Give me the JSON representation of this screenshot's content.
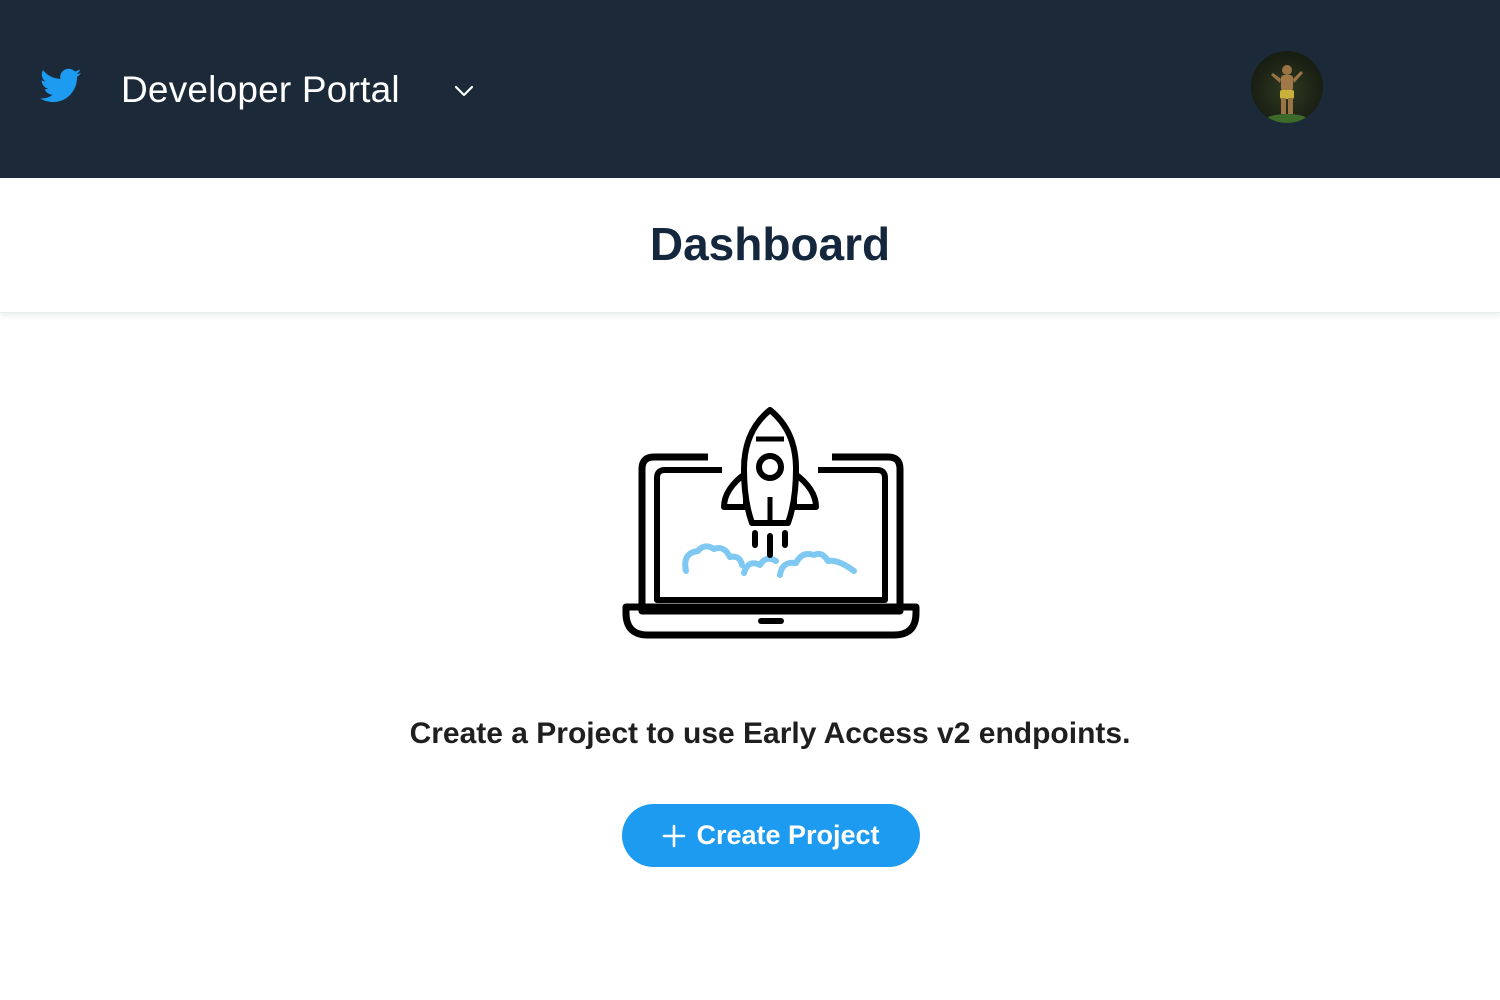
{
  "header": {
    "title": "Developer Portal",
    "logo_icon": "twitter-bird-icon",
    "menu_icon": "chevron-down-icon",
    "avatar_icon": "user-avatar",
    "background_color": "#1c2938",
    "brand_color": "#1d9bf0"
  },
  "page": {
    "title": "Dashboard"
  },
  "empty_state": {
    "illustration_icon": "laptop-rocket-icon",
    "message": "Create a Project to use Early Access v2 endpoints.",
    "button_label": "Create Project",
    "button_icon": "plus-icon",
    "button_color": "#1d9bf0"
  }
}
